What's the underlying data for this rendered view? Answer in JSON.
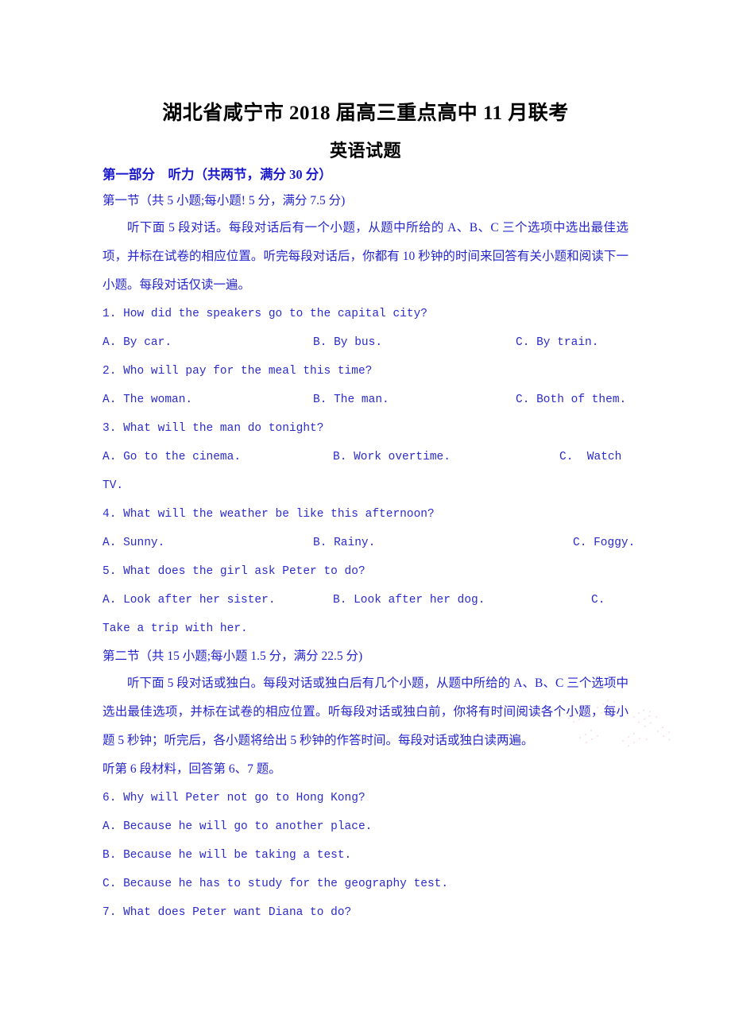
{
  "document": {
    "title_line1": "湖北省咸宁市 2018 届高三重点高中 11 月联考",
    "title_line2": "英语试题"
  },
  "part_one": {
    "heading": "第一部分　听力（共两节，满分 30 分）",
    "section_one": {
      "heading": "第一节（共 5 小题;每小题! 5 分，满分 7.5 分)",
      "instruction": "听下面 5 段对话。每段对话后有一个小题，从题中所给的 A、B、C 三个选项中选出最佳选项，并标在试卷的相应位置。听完每段对话后，你都有 10 秒钟的时间来回答有关小题和阅读下一小题。每段对话仅读一遍。",
      "questions": [
        {
          "stem": "1. How did the speakers go to the capital city?",
          "options": [
            {
              "label": "A. By car."
            },
            {
              "label": "B. By bus."
            },
            {
              "label": "C. By train."
            }
          ]
        },
        {
          "stem": "2. Who will pay for the meal this time?",
          "options": [
            {
              "label": "A. The woman."
            },
            {
              "label": "B. The man."
            },
            {
              "label": "C. Both of them."
            }
          ]
        },
        {
          "stem": "3. What will the man do tonight?",
          "options": [
            {
              "label": "A. Go to the cinema."
            },
            {
              "label": "B. Work overtime."
            },
            {
              "label": "C.  Watch",
              "wrap": "TV."
            }
          ]
        },
        {
          "stem": "4. What will the weather be like this afternoon?",
          "options": [
            {
              "label": "A. Sunny."
            },
            {
              "label": "B. Rainy."
            },
            {
              "label": "C. Foggy."
            }
          ]
        },
        {
          "stem": "5. What does the girl ask Peter to do?",
          "options": [
            {
              "label": "A. Look after her sister."
            },
            {
              "label": "B. Look after her dog."
            },
            {
              "label": "C.",
              "wrap": "Take a trip with her."
            }
          ]
        }
      ]
    },
    "section_two": {
      "heading": "第二节（共 15 小题;每小题 1.5 分，满分 22.5 分)",
      "instruction": "听下面 5 段对话或独白。每段对话或独白后有几个小题，从题中所给的 A、B、C 三个选项中选出最佳选项，并标在试卷的相应位置。听每段对话或独白前，你将有时间阅读各个小题，每小题 5 秒钟；听完后，各小题将给出 5 秒钟的作答时间。每段对话或独白读两遍。",
      "material_cue": "听第 6 段材料，回答第 6、7 题。",
      "questions": [
        {
          "stem": "6. Why will Peter not go to Hong Kong?",
          "options": [
            {
              "label": "A. Because he will go to another place."
            },
            {
              "label": "B. Because he will be taking a test."
            },
            {
              "label": "C. Because he has to study for the geography test."
            }
          ]
        },
        {
          "stem": "7. What does Peter want Diana to do?",
          "options": []
        }
      ]
    }
  },
  "style": {
    "title_color": "#000000",
    "heading_color": "#1a1acc",
    "body_color": "#2525cc",
    "mono_color": "#2b2bcc",
    "watermark_color": "#e8a0a8",
    "page_background": "#ffffff"
  }
}
